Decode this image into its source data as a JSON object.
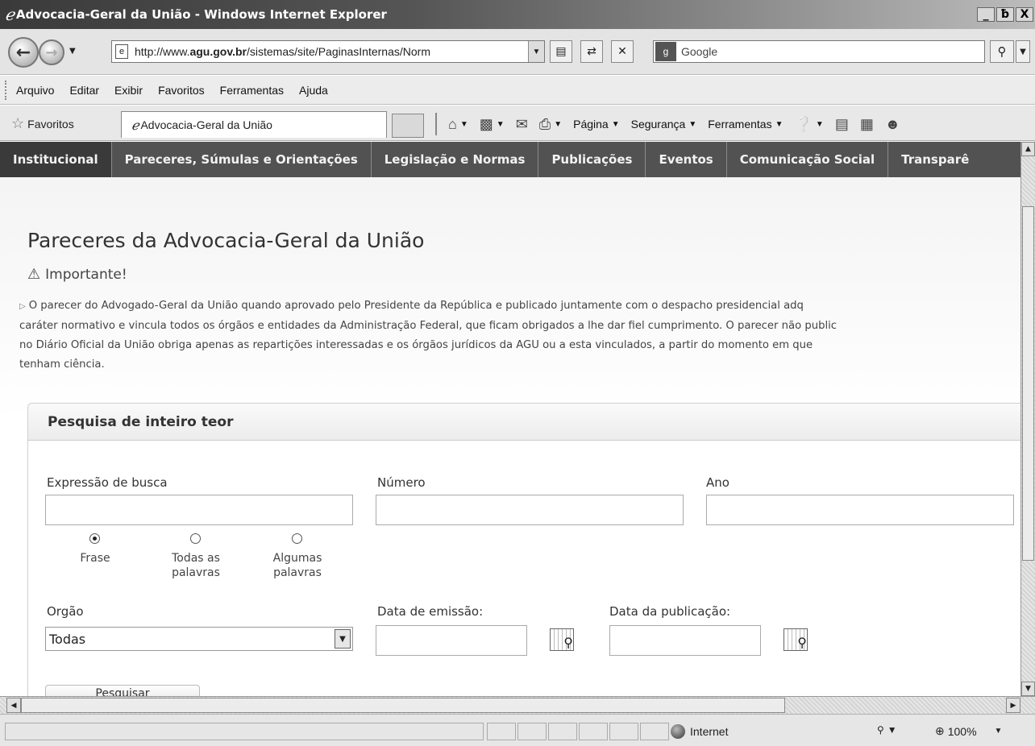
{
  "window": {
    "title": "Advocacia-Geral da União - Windows Internet Explorer",
    "browser_icon": "ie-logo-icon",
    "controls": [
      "_",
      "ƀ",
      "X"
    ]
  },
  "address_bar": {
    "url_prefix": "http://www.",
    "url_domain": "agu.gov.br",
    "url_path": "/sistemas/site/PaginasInternas/Norm",
    "search_placeholder": "Google"
  },
  "menu": {
    "items": [
      "Arquivo",
      "Editar",
      "Exibir",
      "Favoritos",
      "Ferramentas",
      "Ajuda"
    ]
  },
  "favorites_bar": {
    "favorites_label": "Favoritos",
    "tab_title": "Advocacia-Geral da União",
    "commands": {
      "pagina": "Página",
      "seguranca": "Segurança",
      "ferramentas": "Ferramentas"
    }
  },
  "site_nav": {
    "items": [
      "Institucional",
      "Pareceres, Súmulas e Orientações",
      "Legislação e Normas",
      "Publicações",
      "Eventos",
      "Comunicação Social",
      "Transparê"
    ]
  },
  "page": {
    "title": "Pareceres da Advocacia-Geral da União",
    "important_label": "Importante!",
    "notice_lines": [
      "O parecer do Advogado-Geral da União quando aprovado pelo Presidente da República e publicado juntamente com o despacho presidencial adq",
      "caráter normativo e vincula todos os órgãos e entidades da Administração Federal, que ficam obrigados a lhe dar fiel cumprimento. O parecer não public",
      "no Diário Oficial da União obriga apenas as repartições interessadas e os órgãos jurídicos da AGU ou a esta vinculados, a partir do momento em que",
      "tenham ciência."
    ]
  },
  "search_panel": {
    "title": "Pesquisa de inteiro teor",
    "expressao_label": "Expressão de busca",
    "numero_label": "Número",
    "ano_label": "Ano",
    "radio_options": {
      "frase": "Frase",
      "todas_1": "Todas as",
      "todas_2": "palavras",
      "algumas_1": "Algumas",
      "algumas_2": "palavras"
    },
    "selected_radio": "Frase",
    "orgao_label": "Orgão",
    "orgao_value": "Todas",
    "data_emissao_label": "Data de emissão:",
    "data_publicacao_label": "Data da publicação:",
    "search_button": "Pesquisar"
  },
  "status_bar": {
    "zone": "Internet",
    "zoom": "100%"
  }
}
